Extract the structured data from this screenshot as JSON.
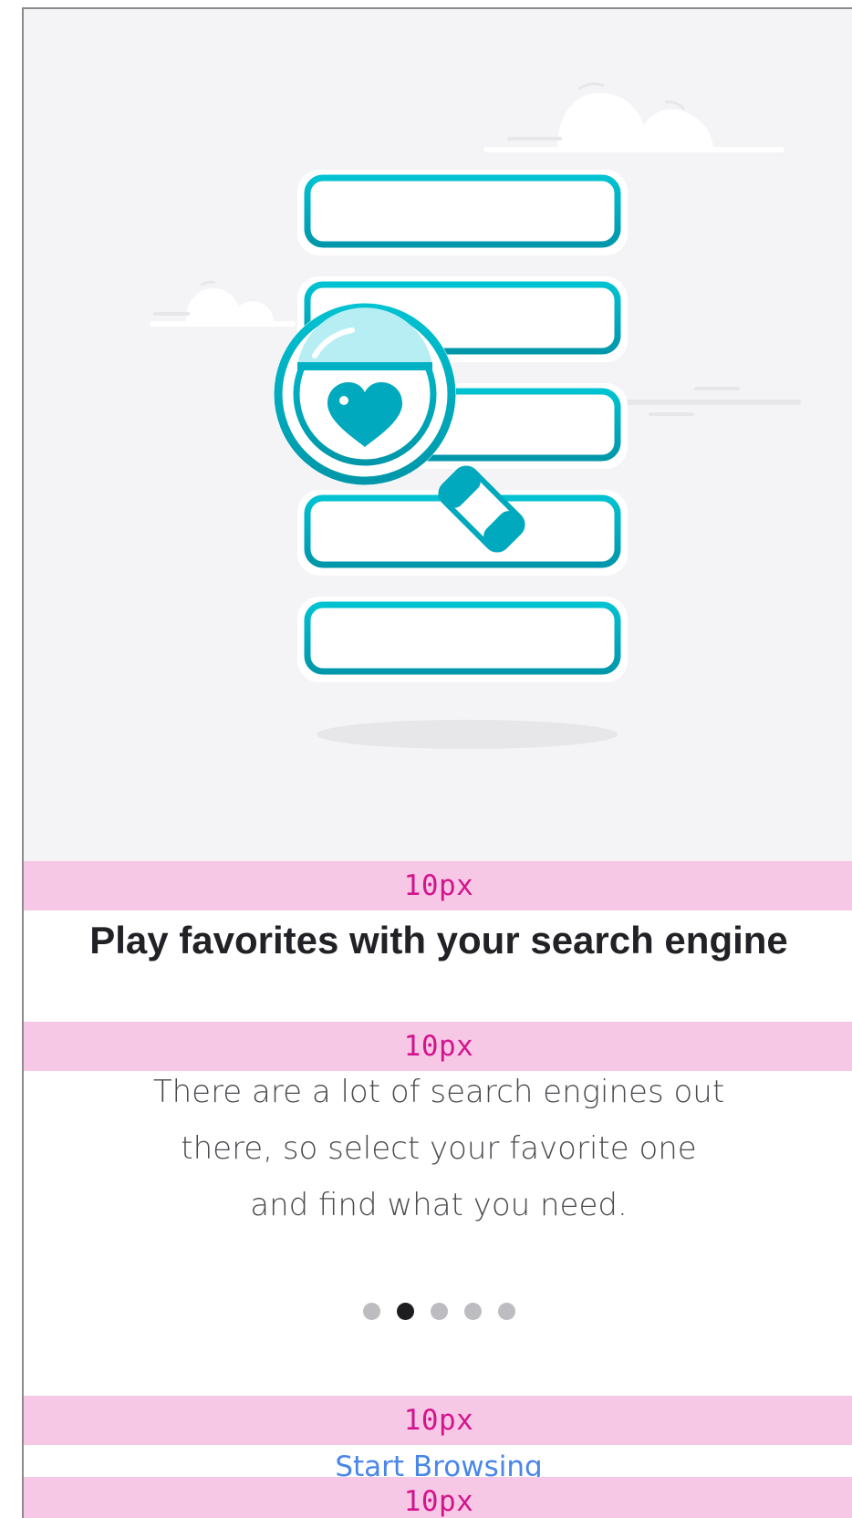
{
  "onboarding": {
    "title": "Play favorites with your search engine",
    "description": "There are a lot of search engines out there, so select your favorite one and find what you need.",
    "start_button_label": "Start Browsing",
    "current_page": 2,
    "total_pages": 5
  },
  "spacers": {
    "above_title": "10px",
    "below_title": "10px",
    "above_button": "10px",
    "below_button": "10px"
  },
  "colors": {
    "accent": "#00b4c8",
    "spacer_fill": "#f7c8e6",
    "spacer_text": "#d4148c",
    "button_text": "#4a86e8",
    "active_dot": "#1d1d20",
    "inactive_dot": "#bdbdc1"
  },
  "icons": {
    "illustration": "search-engine-list-illustration",
    "magnifier": "magnifying-glass-heart-icon"
  }
}
